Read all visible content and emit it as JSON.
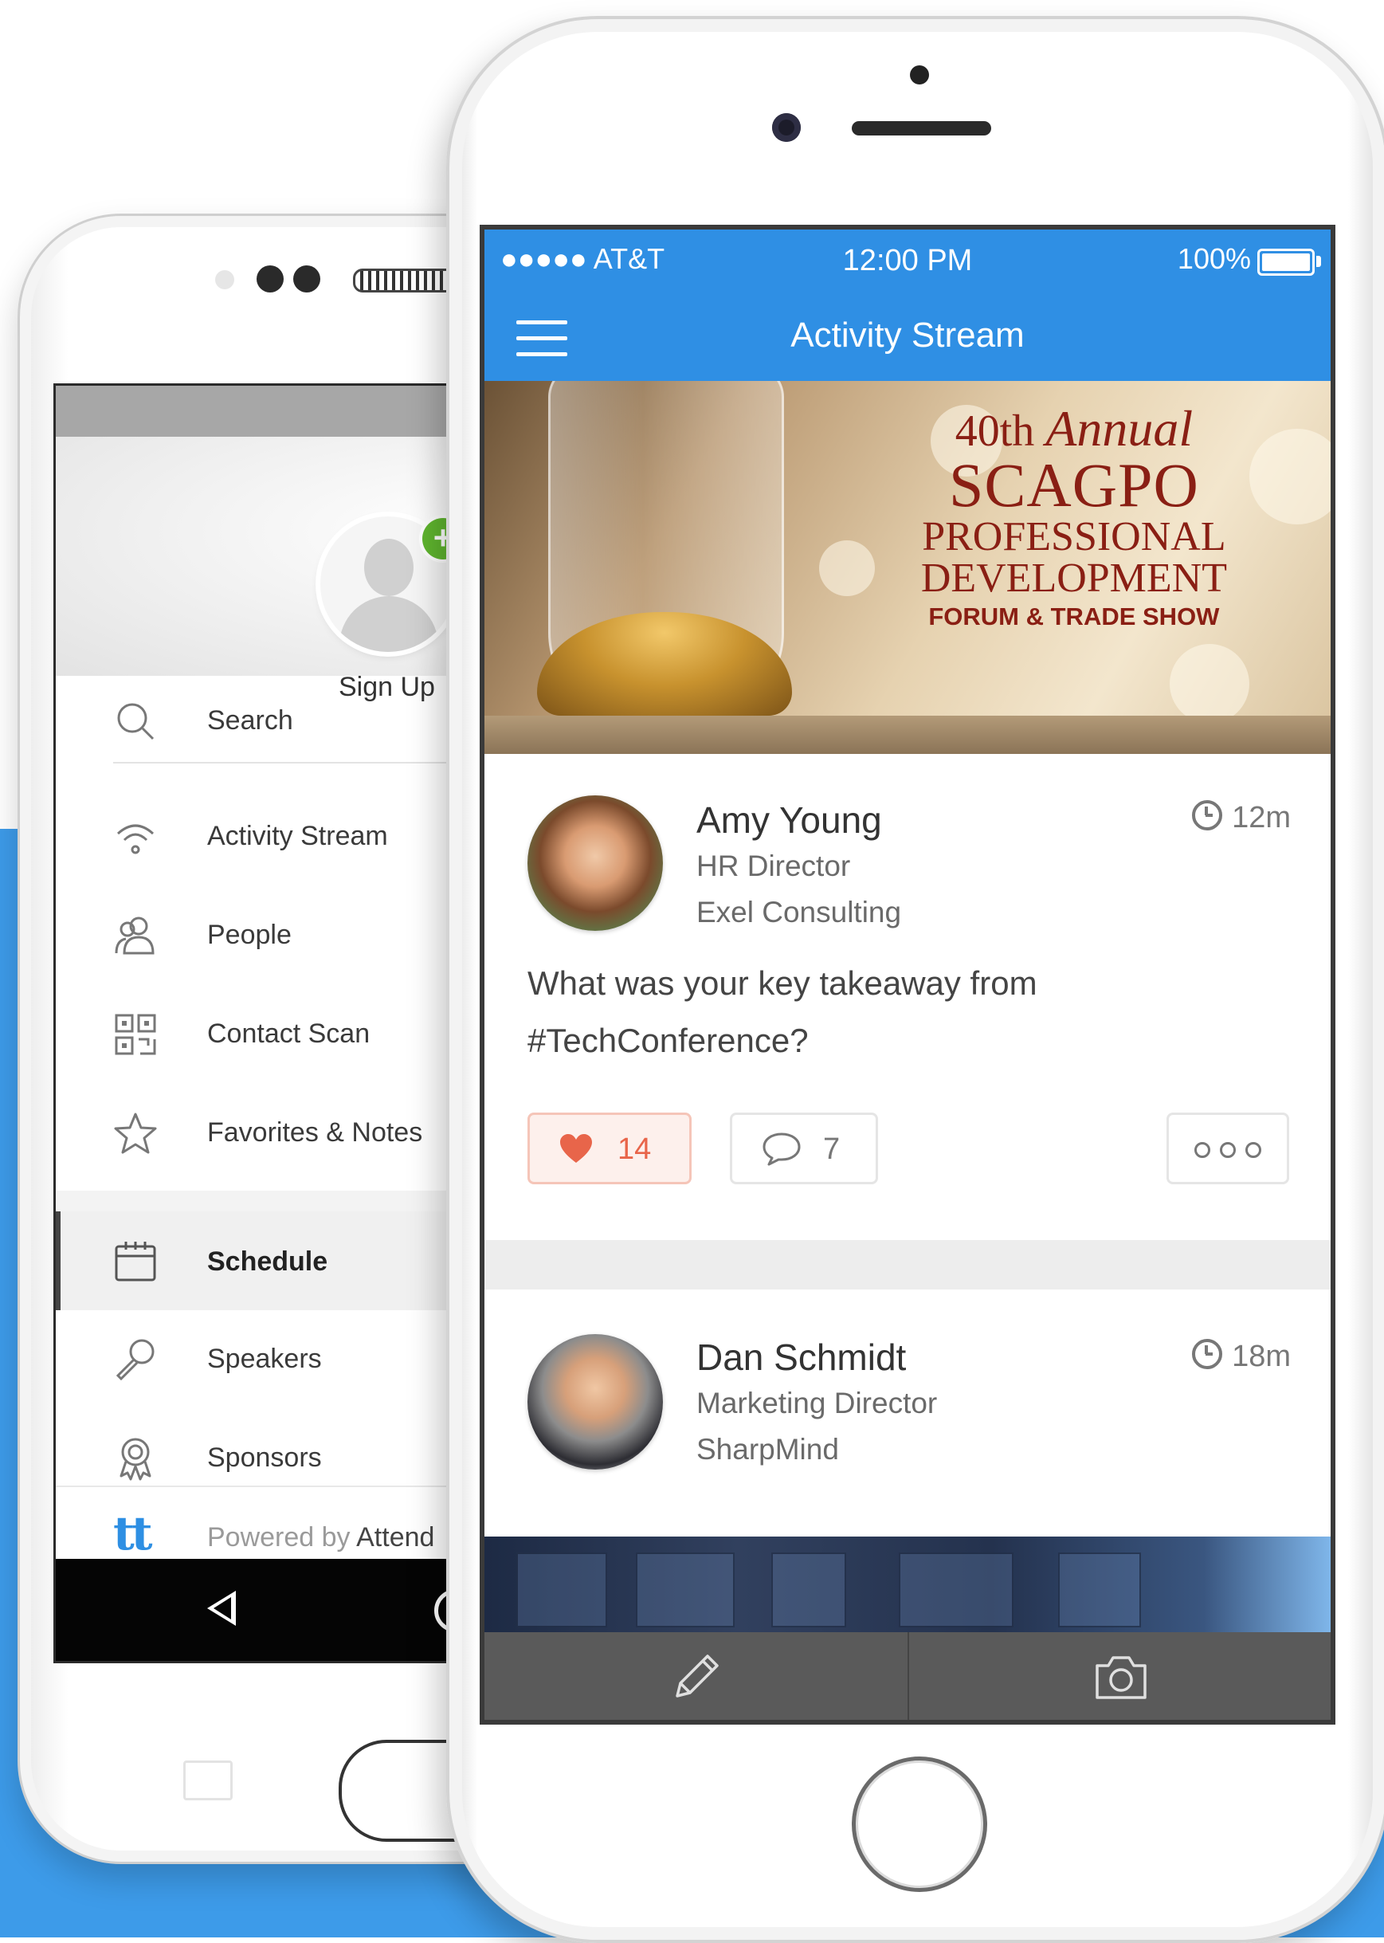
{
  "android": {
    "profile": {
      "signup_label": "Sign Up",
      "plus_badge": "+"
    },
    "menu": [
      {
        "label": "Search",
        "icon": "search-icon"
      },
      {
        "label": "Activity Stream",
        "icon": "wifi-icon"
      },
      {
        "label": "People",
        "icon": "people-icon"
      },
      {
        "label": "Contact Scan",
        "icon": "qr-code-icon"
      },
      {
        "label": "Favorites & Notes",
        "icon": "star-icon"
      },
      {
        "label": "Schedule",
        "icon": "calendar-icon",
        "active": true
      },
      {
        "label": "Speakers",
        "icon": "microphone-icon"
      },
      {
        "label": "Sponsors",
        "icon": "award-icon"
      }
    ],
    "footer": {
      "logo": "tt",
      "powered_prefix": "Powered by ",
      "powered_brand": "Attend"
    }
  },
  "ios": {
    "status": {
      "carrier": "●●●●● AT&T",
      "time": "12:00 PM",
      "battery": "100%"
    },
    "nav": {
      "title": "Activity Stream",
      "menu_icon": "hamburger-icon"
    },
    "banner": {
      "line1_num": "40th",
      "line1_word": "Annual",
      "line2": "SCAGPO",
      "line3": "PROFESSIONAL",
      "line4": "DEVELOPMENT",
      "line5": "FORUM & TRADE SHOW"
    },
    "posts": [
      {
        "name": "Amy Young",
        "title": "HR Director",
        "company": "Exel Consulting",
        "time": "12m",
        "text": "What was your key takeaway from #TechConference?",
        "likes": "14",
        "comments": "7"
      },
      {
        "name": "Dan Schmidt",
        "title": "Marketing Director",
        "company": "SharpMind",
        "time": "18m"
      }
    ],
    "tabbar": [
      {
        "icon": "pencil-icon"
      },
      {
        "icon": "camera-icon"
      }
    ]
  },
  "colors": {
    "accent_blue": "#2f8fe4",
    "background_blue": "#3d9be9",
    "like_red": "#e8654a",
    "badge_green": "#5fb52e"
  }
}
